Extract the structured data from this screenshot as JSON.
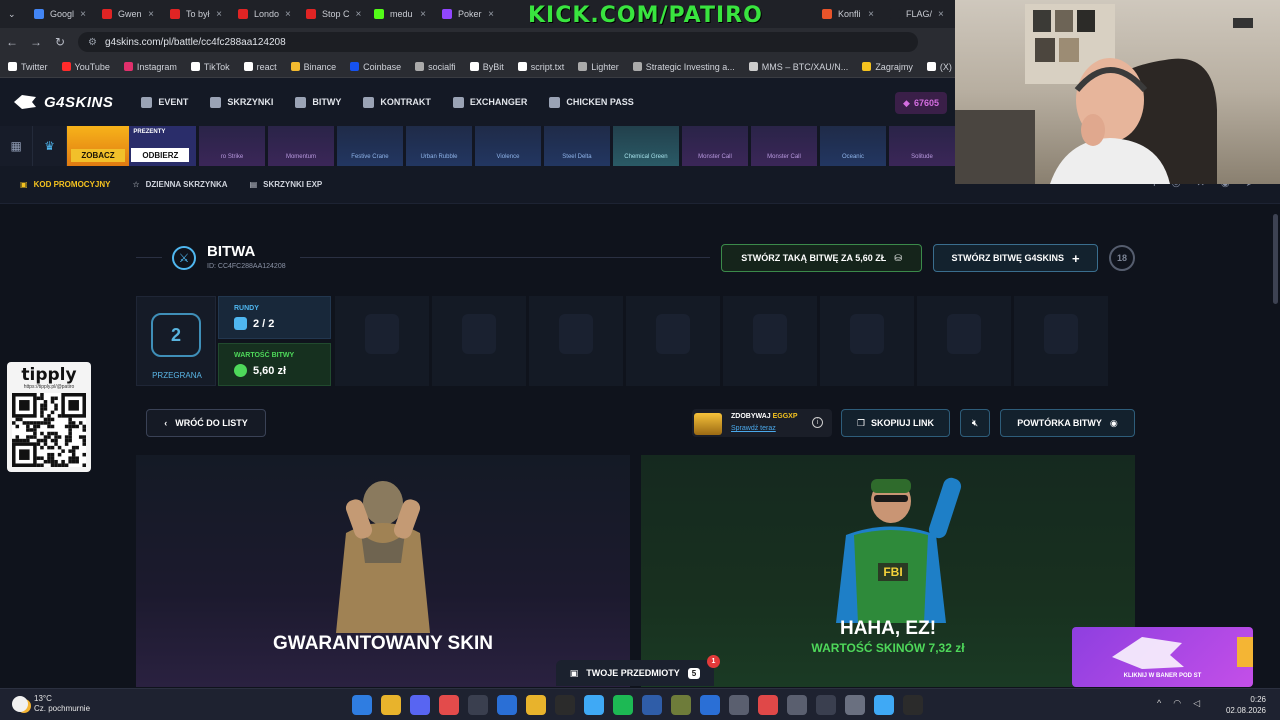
{
  "browser": {
    "tabs": [
      {
        "label": "Googl",
        "color": "#4285f4"
      },
      {
        "label": "Gwen",
        "color": "#e02424"
      },
      {
        "label": "To był",
        "color": "#e02424"
      },
      {
        "label": "Londo",
        "color": "#e02424"
      },
      {
        "label": "Stop C",
        "color": "#e02424"
      },
      {
        "label": "medu",
        "color": "#53fc18"
      },
      {
        "label": "Poker",
        "color": "#9146ff"
      }
    ],
    "tabs_right": [
      {
        "label": "Konfli",
        "color": "#e8542a"
      },
      {
        "label": "FLAG/",
        "color": "#1f2127"
      }
    ],
    "overlay_text": "KICK.COM/PATIRO",
    "url": "g4skins.com/pl/battle/cc4fc288aa124208",
    "bookmarks": [
      "Twitter",
      "YouTube",
      "Instagram",
      "TikTok",
      "react",
      "Binance",
      "Coinbase",
      "socialfi",
      "ByBit",
      "script.txt",
      "Lighter",
      "Strategic Investing a...",
      "MMS – BTC/XAU/N...",
      "Zagrajmy",
      "(X) DeFi Warhol on..."
    ]
  },
  "site": {
    "logo": "G4SKINS",
    "nav": [
      "EVENT",
      "SKRZYNKI",
      "BITWY",
      "KONTRAKT",
      "EXCHANGER",
      "CHICKEN PASS"
    ],
    "balance": "67605",
    "drop_strip": {
      "promo_button": "ZOBACZ",
      "present_label": "PREZENTY",
      "present_button": "ODBIERZ",
      "items": [
        {
          "name": "ro Strike",
          "tone": "purple"
        },
        {
          "name": "Momentum",
          "tone": "purple"
        },
        {
          "name": "Festive Crane",
          "tone": "blue"
        },
        {
          "name": "Urban Rubble",
          "tone": "blue"
        },
        {
          "name": "Violence",
          "tone": "blue"
        },
        {
          "name": "Steel Delta",
          "tone": "blue"
        },
        {
          "name": "Chemical Green",
          "tone": "teal"
        },
        {
          "name": "Monster Call",
          "tone": "purple"
        },
        {
          "name": "Monster Call",
          "tone": "purple"
        },
        {
          "name": "Oceanic",
          "tone": "blue"
        },
        {
          "name": "Solitude",
          "tone": "purple"
        }
      ]
    },
    "subnav": [
      "KOD PROMOCYJNY",
      "DZIENNA SKRZYNKA",
      "SKRZYNKI EXP"
    ]
  },
  "battle": {
    "title": "BITWA",
    "id_text": "ID: CC4FC288AA124208",
    "create_same_label": "STWÓRZ TAKĄ BITWĘ ZA 5,60 ZŁ",
    "create_g4_label": "STWÓRZ BITWĘ G4SKINS",
    "age_badge": "18",
    "result_label": "PRZEGRANA",
    "result_number": "2",
    "rounds_label": "RUNDY",
    "rounds_value": "2 / 2",
    "value_label": "WARTOŚĆ BITWY",
    "value_value": "5,60 zł",
    "back_label": "WRÓĆ DO LISTY",
    "eggxp_prefix": "ZDOBYWAJ ",
    "eggxp_highlight": "EGGXP",
    "eggxp_link": "Sprawdź teraz",
    "copy_label": "SKOPIUJ LINK",
    "replay_label": "POWTÓRKA BITWY",
    "left_player_text": "GWARANTOWANY SKIN",
    "right_player_text": "HAHA, EZ!",
    "right_player_value": "WARTOŚĆ SKINÓW 7,32 zł",
    "items_label": "TWOJE PRZEDMIOTY",
    "items_count": "5",
    "items_badge": "1"
  },
  "tipply": {
    "name": "tipply",
    "url": "https://tipply.pl/@patiro"
  },
  "banner": {
    "text": "KLIKNIJ W BANER POD ST"
  },
  "taskbar": {
    "temp": "13°C",
    "weather": "Cz. pochmurnie",
    "time": "0:26",
    "date": "02.08.2026"
  },
  "colors": {
    "accent_yellow": "#f4c21f",
    "accent_green": "#4ed85a",
    "accent_blue": "#4fb7f0",
    "kick_green": "#39e43f"
  }
}
